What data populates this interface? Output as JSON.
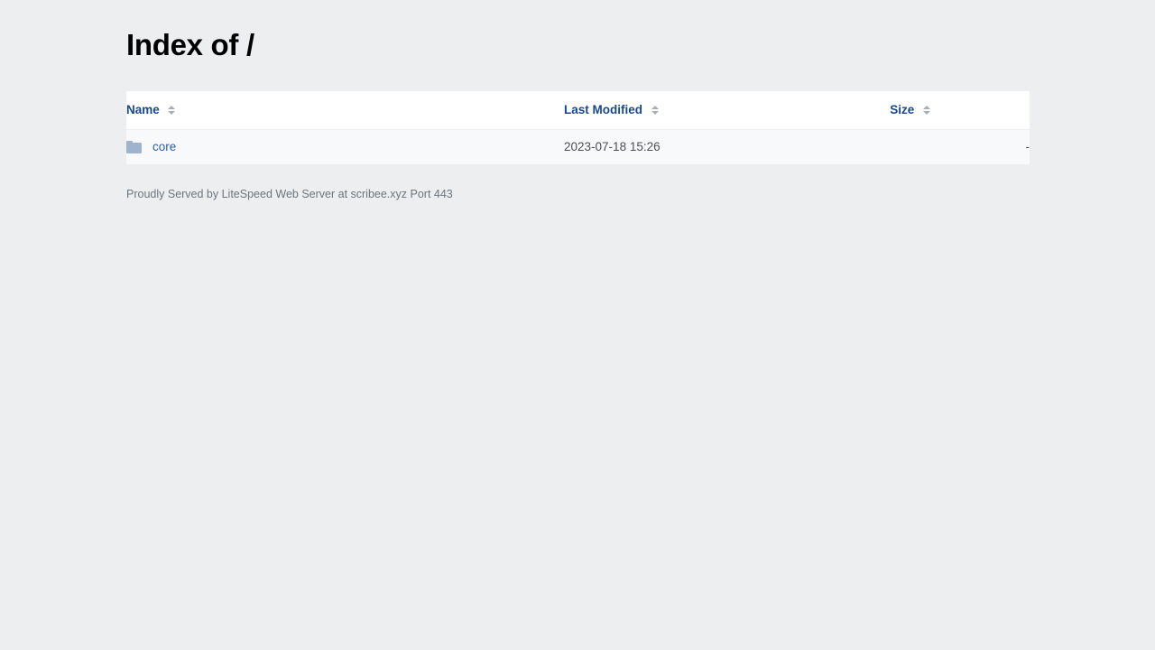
{
  "page": {
    "title": "Index of /",
    "background_color": "#eceef0"
  },
  "table": {
    "columns": [
      {
        "key": "name",
        "label": "Name",
        "align": "left",
        "sortable": true,
        "sort_icon": "sort-updown-icon"
      },
      {
        "key": "last_modified",
        "label": "Last Modified",
        "align": "left",
        "sortable": true,
        "sort_icon": "sort-updown-icon"
      },
      {
        "key": "size",
        "label": "Size",
        "align": "right",
        "sortable": true,
        "sort_icon": "sort-updown-icon"
      }
    ],
    "rows": [
      {
        "icon": "folder-icon",
        "name": "core",
        "last_modified": "2023-07-18 15:26",
        "size": "-"
      }
    ]
  },
  "footer": {
    "text": "Proudly Served by LiteSpeed Web Server at scribee.xyz Port 443"
  },
  "colors": {
    "header_link": "#17478f",
    "row_link": "#2f5fa8",
    "folder": "#9fb3ca",
    "row_background": "#f8f9fa",
    "header_background": "#ffffff",
    "muted_text": "#6c757d"
  }
}
